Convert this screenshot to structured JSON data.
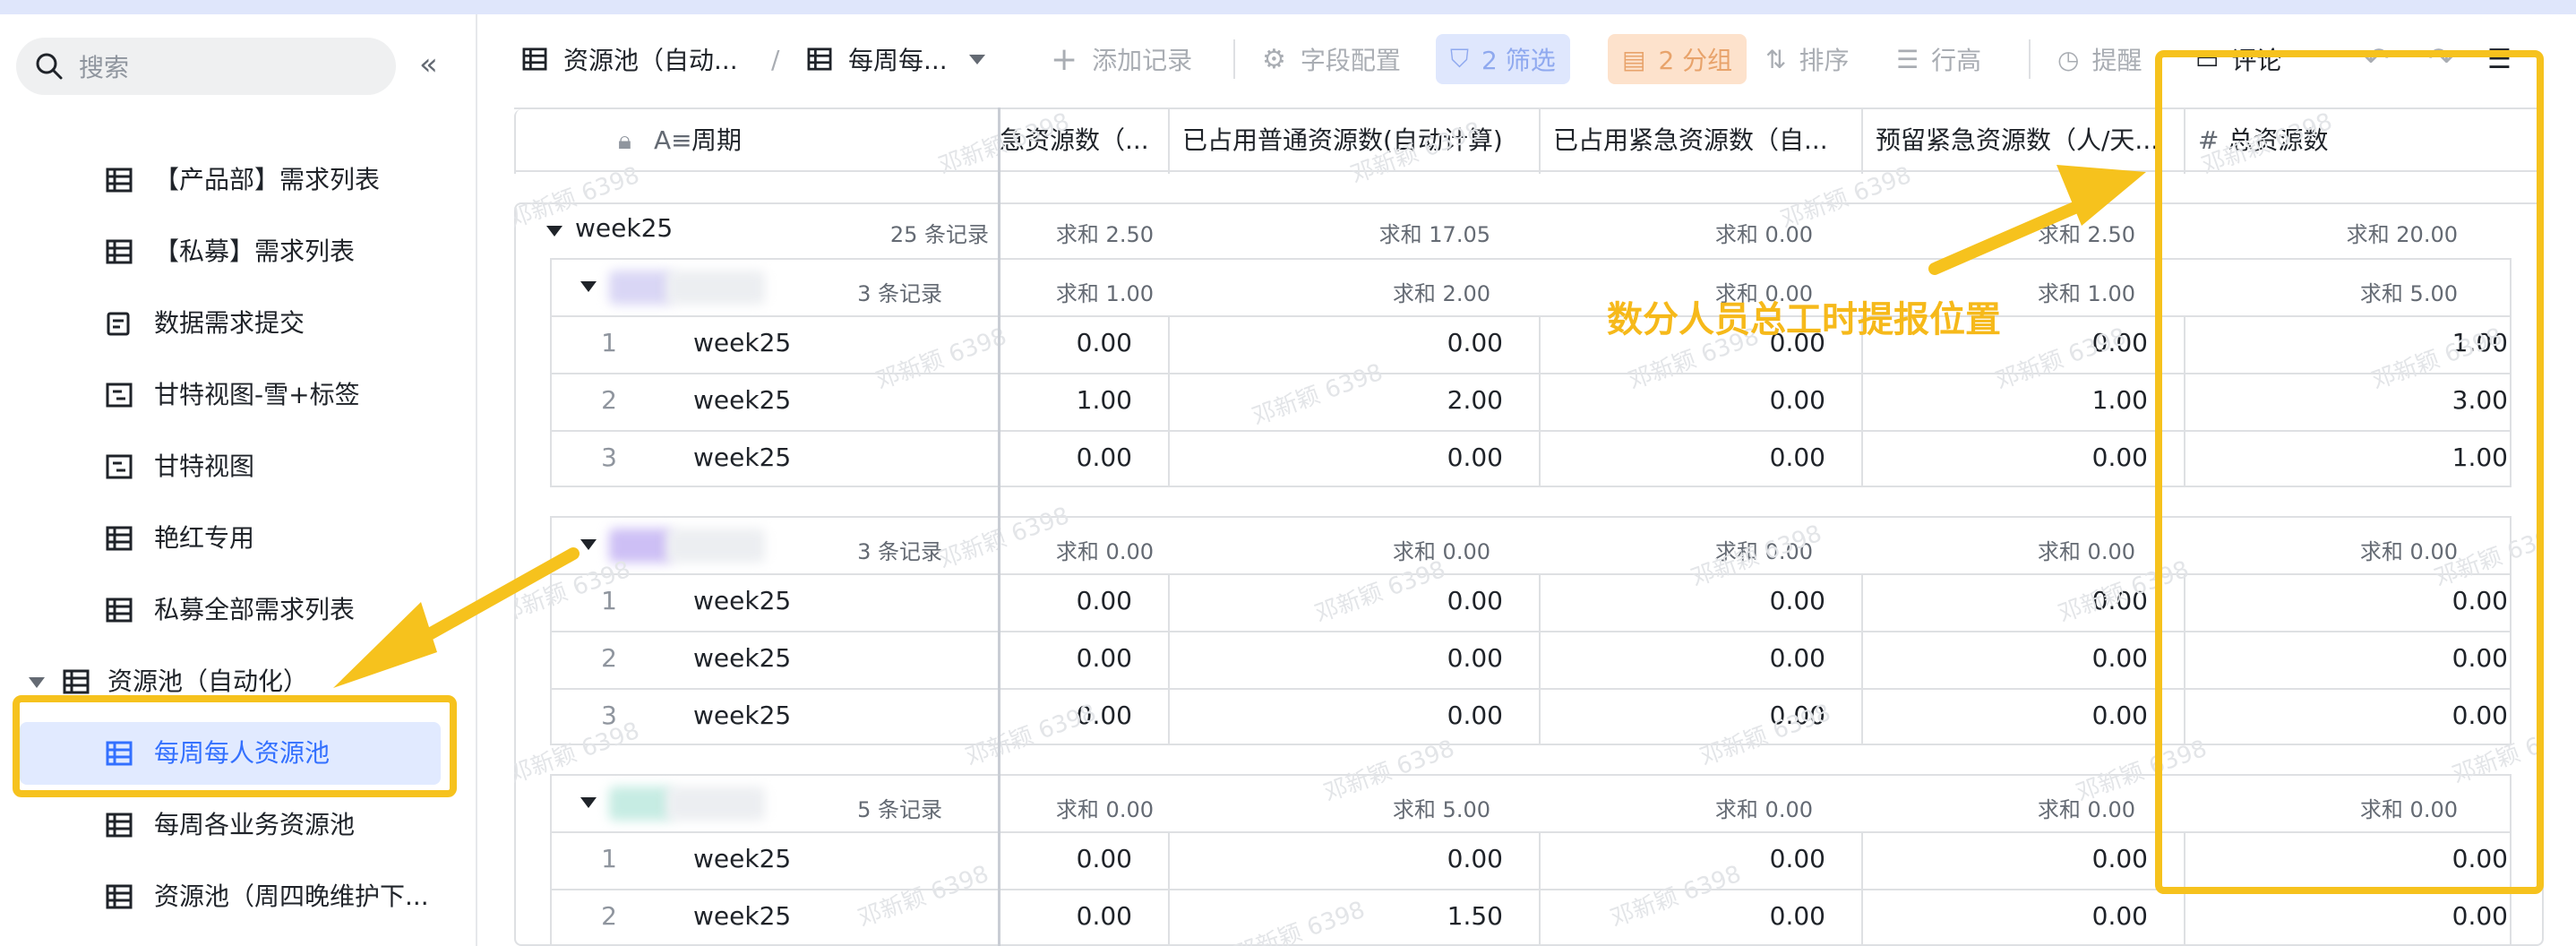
{
  "sidebar": {
    "search_placeholder": "搜索",
    "items": [
      {
        "label": "【产品部】需求列表"
      },
      {
        "label": "【私募】需求列表"
      },
      {
        "label": "数据需求提交"
      },
      {
        "label": "甘特视图-雪+标签"
      },
      {
        "label": "甘特视图"
      },
      {
        "label": "艳红专用"
      },
      {
        "label": "私募全部需求列表"
      }
    ],
    "group_label": "资源池（自动化）",
    "active_item": "每周每人资源池",
    "sub_items": [
      "每周各业务资源池",
      "资源池（周四晚维护下..."
    ]
  },
  "toolbar": {
    "breadcrumb_table": "资源池（自动...",
    "breadcrumb_view": "每周每...",
    "add_record": "添加记录",
    "field_config": "字段配置",
    "filter": "2 筛选",
    "group": "2 分组",
    "sort": "排序",
    "row_height": "行高",
    "remind": "提醒",
    "comment": "评论"
  },
  "columns": {
    "period": "周期",
    "c1": "急资源数（...",
    "c2": "已占用普通资源数(自动计算)",
    "c3": "已占用紧急资源数（自...",
    "c4": "预留紧急资源数（人/天...",
    "c5": "总资源数"
  },
  "top_group": {
    "name": "week25",
    "count": "25 条记录",
    "sums": [
      "求和 2.50",
      "求和 17.05",
      "求和 0.00",
      "求和 2.50",
      "求和 20.00"
    ]
  },
  "sub_groups": [
    {
      "count": "3 条记录",
      "swatch": "#d9d6f5",
      "sums": [
        "求和 1.00",
        "求和 2.00",
        "求和 0.00",
        "求和 1.00",
        "求和 5.00"
      ],
      "rows": [
        {
          "idx": "1",
          "period": "week25",
          "v": [
            "0.00",
            "0.00",
            "0.00",
            "0.00",
            "1.00"
          ]
        },
        {
          "idx": "2",
          "period": "week25",
          "v": [
            "1.00",
            "2.00",
            "0.00",
            "1.00",
            "3.00"
          ]
        },
        {
          "idx": "3",
          "period": "week25",
          "v": [
            "0.00",
            "0.00",
            "0.00",
            "0.00",
            "1.00"
          ]
        }
      ]
    },
    {
      "count": "3 条记录",
      "swatch": "#cdbff5",
      "sums": [
        "求和 0.00",
        "求和 0.00",
        "求和 0.00",
        "求和 0.00",
        "求和 0.00"
      ],
      "rows": [
        {
          "idx": "1",
          "period": "week25",
          "v": [
            "0.00",
            "0.00",
            "0.00",
            "0.00",
            "0.00"
          ]
        },
        {
          "idx": "2",
          "period": "week25",
          "v": [
            "0.00",
            "0.00",
            "0.00",
            "0.00",
            "0.00"
          ]
        },
        {
          "idx": "3",
          "period": "week25",
          "v": [
            "0.00",
            "0.00",
            "0.00",
            "0.00",
            "0.00"
          ]
        }
      ]
    },
    {
      "count": "5 条记录",
      "swatch": "#c6ece3",
      "sums": [
        "求和 0.00",
        "求和 5.00",
        "求和 0.00",
        "求和 0.00",
        "求和 0.00"
      ],
      "rows": [
        {
          "idx": "1",
          "period": "week25",
          "v": [
            "0.00",
            "0.00",
            "0.00",
            "0.00",
            "0.00"
          ]
        },
        {
          "idx": "2",
          "period": "week25",
          "v": [
            "0.00",
            "1.50",
            "0.00",
            "0.00",
            "0.00"
          ]
        }
      ]
    }
  ],
  "annotation": {
    "text": "数分人员总工时提报位置",
    "color": "#f6c21d"
  },
  "watermark": "邓新颖 6398",
  "colors": {
    "accent": "#3370ff",
    "active_bg": "#e1eaff",
    "filter_bg": "#dfe7fd",
    "group_bg": "#fde2cc",
    "annotation": "#f6c21d"
  }
}
